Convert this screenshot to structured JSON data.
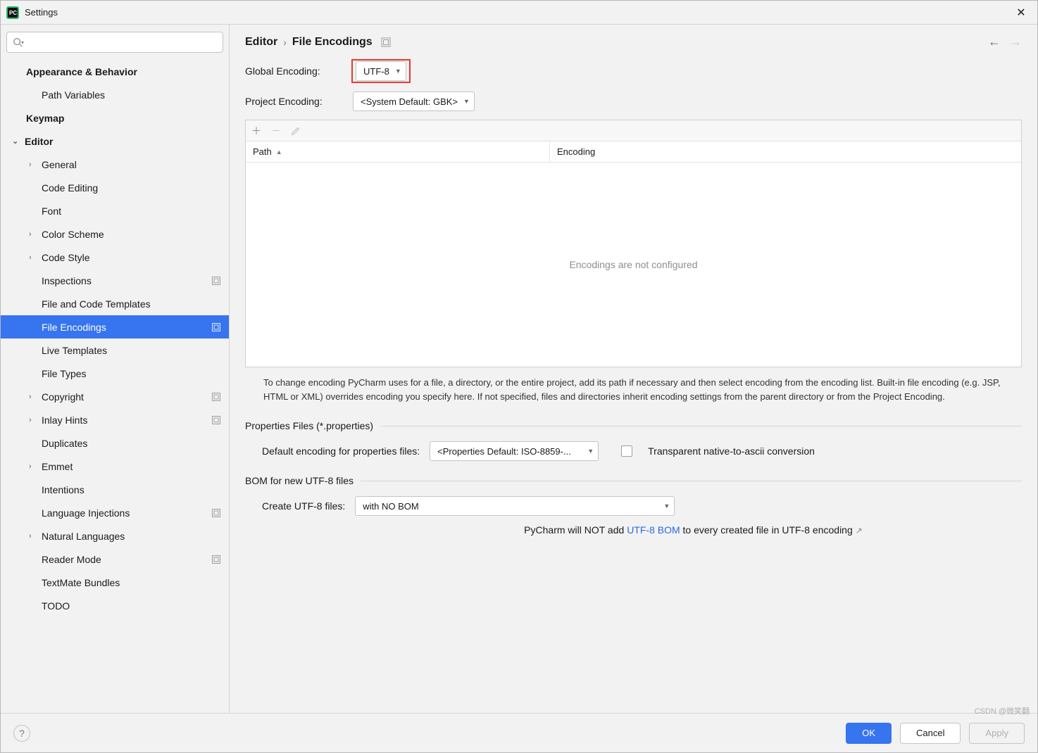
{
  "window": {
    "title": "Settings"
  },
  "breadcrumb": {
    "root": "Editor",
    "leaf": "File Encodings"
  },
  "sidebar": {
    "items": [
      {
        "label": "Appearance & Behavior",
        "level": 1,
        "bold": true
      },
      {
        "label": "Path Variables",
        "level": 2
      },
      {
        "label": "Keymap",
        "level": 1,
        "bold": true
      },
      {
        "label": "Editor",
        "level": 1,
        "bold": true,
        "expanded": true
      },
      {
        "label": "General",
        "level": 2,
        "arrow": true
      },
      {
        "label": "Code Editing",
        "level": 2
      },
      {
        "label": "Font",
        "level": 2
      },
      {
        "label": "Color Scheme",
        "level": 2,
        "arrow": true
      },
      {
        "label": "Code Style",
        "level": 2,
        "arrow": true
      },
      {
        "label": "Inspections",
        "level": 2,
        "ind": true
      },
      {
        "label": "File and Code Templates",
        "level": 2
      },
      {
        "label": "File Encodings",
        "level": 2,
        "ind": true,
        "selected": true
      },
      {
        "label": "Live Templates",
        "level": 2
      },
      {
        "label": "File Types",
        "level": 2
      },
      {
        "label": "Copyright",
        "level": 2,
        "arrow": true,
        "ind": true
      },
      {
        "label": "Inlay Hints",
        "level": 2,
        "arrow": true,
        "ind": true
      },
      {
        "label": "Duplicates",
        "level": 2
      },
      {
        "label": "Emmet",
        "level": 2,
        "arrow": true
      },
      {
        "label": "Intentions",
        "level": 2
      },
      {
        "label": "Language Injections",
        "level": 2,
        "ind": true
      },
      {
        "label": "Natural Languages",
        "level": 2,
        "arrow": true
      },
      {
        "label": "Reader Mode",
        "level": 2,
        "ind": true
      },
      {
        "label": "TextMate Bundles",
        "level": 2
      },
      {
        "label": "TODO",
        "level": 2
      }
    ]
  },
  "globalEncoding": {
    "label": "Global Encoding:",
    "value": "UTF-8"
  },
  "projectEncoding": {
    "label": "Project Encoding:",
    "value": "<System Default: GBK>"
  },
  "table": {
    "colPath": "Path",
    "colEncoding": "Encoding",
    "empty": "Encodings are not configured"
  },
  "help": "To change encoding PyCharm uses for a file, a directory, or the entire project, add its path if necessary and then select encoding from the encoding list. Built-in file encoding (e.g. JSP, HTML or XML) overrides encoding you specify here. If not specified, files and directories inherit encoding settings from the parent directory or from the Project Encoding.",
  "props": {
    "heading": "Properties Files (*.properties)",
    "label": "Default encoding for properties files:",
    "value": "<Properties Default: ISO-8859-...",
    "transparent": "Transparent native-to-ascii conversion"
  },
  "bom": {
    "heading": "BOM for new UTF-8 files",
    "label": "Create UTF-8 files:",
    "value": "with NO BOM",
    "note1": "PyCharm will NOT add ",
    "noteLink": "UTF-8 BOM",
    "note2": " to every created file in UTF-8 encoding"
  },
  "buttons": {
    "ok": "OK",
    "cancel": "Cancel",
    "apply": "Apply"
  },
  "watermark": "CSDN @微笑翻"
}
